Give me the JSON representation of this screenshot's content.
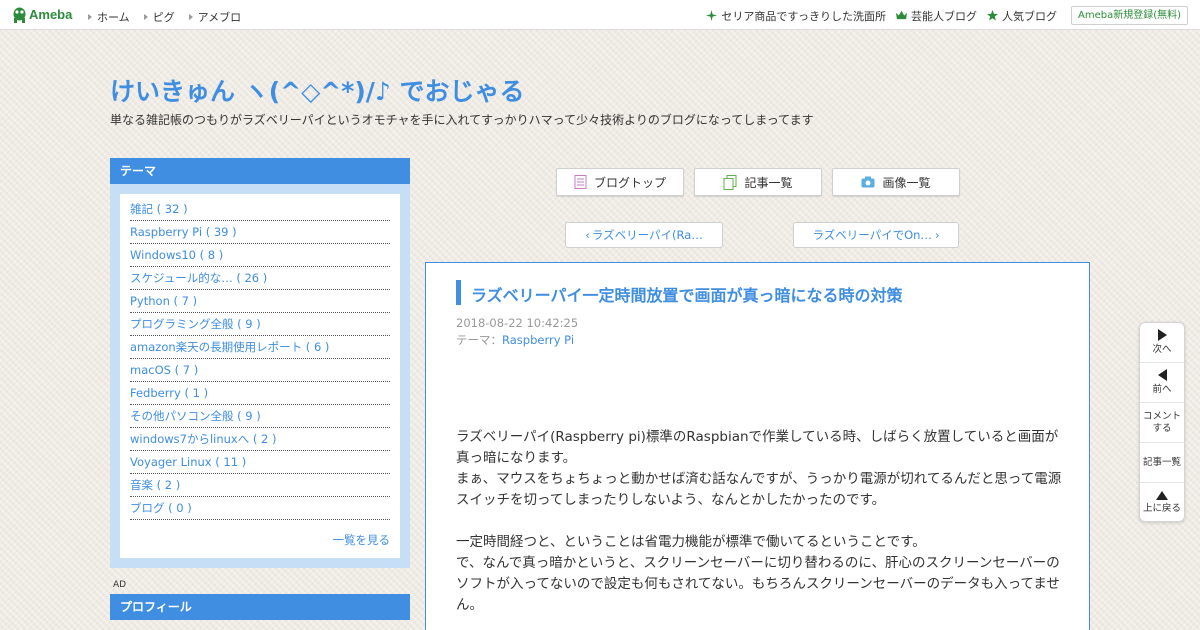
{
  "topbar": {
    "logo_text": "Ameba",
    "nav": [
      "ホーム",
      "ピグ",
      "アメブロ"
    ],
    "links": [
      {
        "icon": "sparkle-icon",
        "label": "セリア商品ですっきりした洗面所"
      },
      {
        "icon": "crown-icon",
        "label": "芸能人ブログ"
      },
      {
        "icon": "star-icon",
        "label": "人気ブログ"
      }
    ],
    "signup_label": "Ameba新規登録(無料)"
  },
  "blog": {
    "title": "けいきゅん ヽ(^◇^*)/♪ でおじゃる",
    "description": "単なる雑記帳のつもりがラズベリーパイというオモチャを手に入れてすっかりハマって少々技術よりのブログになってしまってます"
  },
  "sidebar": {
    "theme_heading": "テーマ",
    "themes": [
      "雑記 ( 32 )",
      "Raspberry Pi ( 39 )",
      "Windows10 ( 8 )",
      "スケジュール的な… ( 26 )",
      "Python ( 7 )",
      "プログラミング全般 ( 9 )",
      "amazon楽天の長期使用レポート ( 6 )",
      "macOS ( 7 )",
      "Fedberry ( 1 )",
      "その他パソコン全般 ( 9 )",
      "windows7からlinuxへ ( 2 )",
      "Voyager Linux ( 11 )",
      "音楽 ( 2 )",
      "ブログ ( 0 )"
    ],
    "see_all": "一覧を見る",
    "ad_label": "AD",
    "profile_heading": "プロフィール"
  },
  "nav": {
    "blog_top": "ブログトップ",
    "article_list": "記事一覧",
    "image_list": "画像一覧",
    "prev_post": "ラズベリーパイ(Ra…",
    "next_post": "ラズベリーパイでOn…"
  },
  "article": {
    "title": "ラズベリーパイ一定時間放置で画面が真っ暗になる時の対策",
    "date": "2018-08-22 10:42:25",
    "theme_prefix": "テーマ：",
    "theme": "Raspberry Pi",
    "paragraphs": [
      "ラズベリーパイ(Raspberry pi)標準のRaspbianで作業している時、しばらく放置していると画面が真っ暗になります。",
      "まぁ、マウスをちょちょっと動かせば済む話なんですが、うっかり電源が切れてるんだと思って電源スイッチを切ってしまったりしないよう、なんとかしたかったのです。",
      "",
      "一定時間経つと、ということは省電力機能が標準で働いてるということです。",
      "で、なんで真っ暗かというと、スクリーンセーバーに切り替わるのに、肝心のスクリーンセーバーのソフトが入ってないので設定も何もされてない。もちろんスクリーンセーバーのデータも入ってません。"
    ]
  },
  "sidenav": {
    "next": "次へ",
    "prev": "前へ",
    "comment_line1": "コメント",
    "comment_line2": "する",
    "list": "記事一覧",
    "top": "上に戻る"
  },
  "colors": {
    "accent": "#3f8ee1",
    "ameba_green": "#2d8c3c",
    "sidebar_bg": "#c6dff7"
  }
}
